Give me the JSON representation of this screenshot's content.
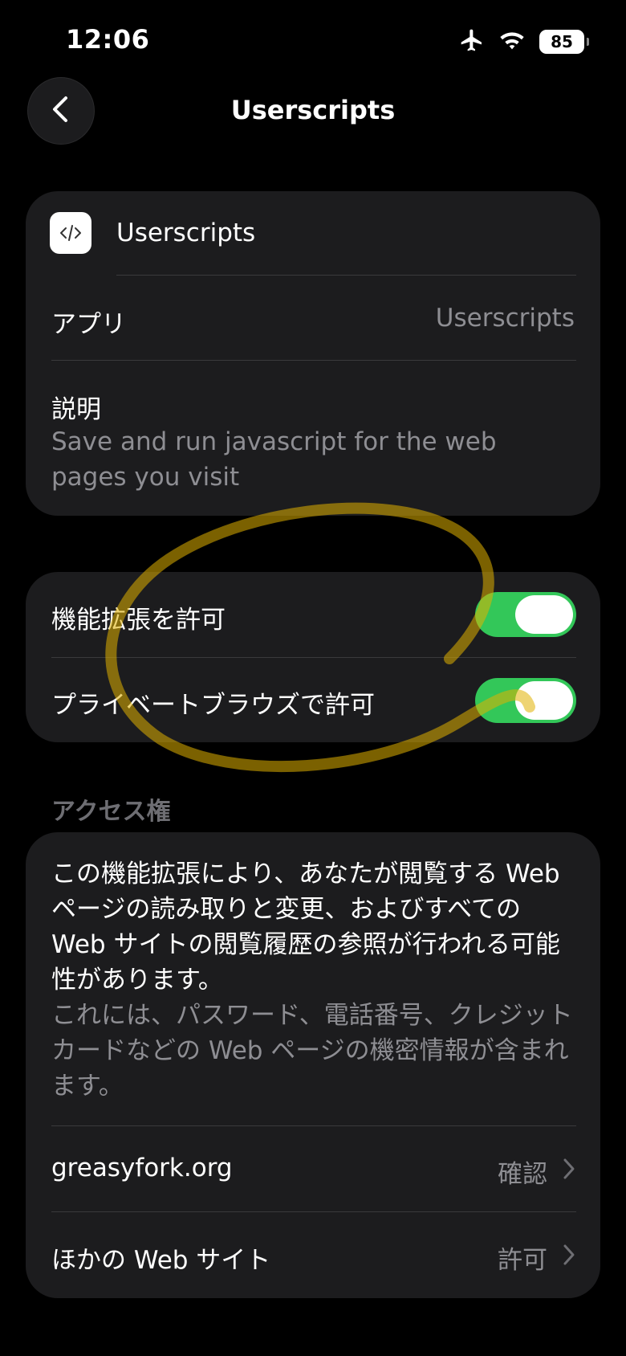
{
  "status_bar": {
    "time": "12:06",
    "battery": "85"
  },
  "nav": {
    "title": "Userscripts"
  },
  "info_card": {
    "extension_name": "Userscripts",
    "app_label": "アプリ",
    "app_value": "Userscripts",
    "description_label": "説明",
    "description_value": "Save and run javascript for the web pages you visit"
  },
  "toggles": [
    {
      "label": "機能拡張を許可",
      "on": true
    },
    {
      "label": "プライベートブラウズで許可",
      "on": true
    }
  ],
  "access": {
    "header": "アクセス権",
    "main_text": "この機能拡張により、あなたが閲覧する Web ページの読み取りと変更、およびすべての Web サイトの閲覧履歴の参照が行われる可能性があります。",
    "sub_text": "これには、パスワード、電話番号、クレジットカードなどの Web ページの機密情報が含まれます。",
    "rows": [
      {
        "label": "greasyfork.org",
        "value": "確認"
      },
      {
        "label": "ほかの Web サイト",
        "value": "許可"
      }
    ]
  },
  "colors": {
    "toggle_on": "#33c759",
    "card": "#1c1c1e",
    "highlight": "#e0b000"
  }
}
